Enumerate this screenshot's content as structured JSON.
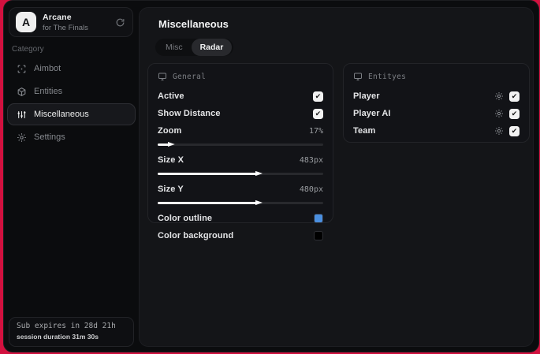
{
  "window": {
    "accent_edge_color": "#d2113f"
  },
  "sidebar": {
    "brand": {
      "initial": "A",
      "title": "Arcane",
      "subtitle": "for The Finals",
      "action_icon": "refresh-icon"
    },
    "category_label": "Category",
    "items": [
      {
        "label": "Aimbot",
        "icon": "crosshair-icon",
        "active": false
      },
      {
        "label": "Entities",
        "icon": "entities-icon",
        "active": false
      },
      {
        "label": "Miscellaneous",
        "icon": "sliders-icon",
        "active": true
      },
      {
        "label": "Settings",
        "icon": "gear-icon",
        "active": false
      }
    ],
    "footer": {
      "line1": "Sub expires in 28d 21h",
      "line2": "session duration 31m 30s"
    }
  },
  "main": {
    "title": "Miscellaneous",
    "tabs": [
      {
        "label": "Misc",
        "active": false
      },
      {
        "label": "Radar",
        "active": true
      }
    ],
    "general": {
      "header": "General",
      "header_icon": "monitor-icon",
      "toggles": [
        {
          "label": "Active",
          "checked": true,
          "check_glyph": "✔"
        },
        {
          "label": "Show Distance",
          "checked": true,
          "check_glyph": "✔"
        }
      ],
      "sliders": [
        {
          "label": "Zoom",
          "value": "17%",
          "percent": 7
        },
        {
          "label": "Size X",
          "value": "483px",
          "percent": 60
        },
        {
          "label": "Size Y",
          "value": "480px",
          "percent": 60
        }
      ],
      "colors": [
        {
          "label": "Color outline",
          "color": "#4a8fe0"
        },
        {
          "label": "Color background",
          "color": "#000000"
        }
      ]
    },
    "entities": {
      "header": "Entityes",
      "header_icon": "monitor-icon",
      "rows": [
        {
          "label": "Player",
          "checked": true,
          "check_glyph": "✔"
        },
        {
          "label": "Player AI",
          "checked": true,
          "check_glyph": "✔"
        },
        {
          "label": "Team",
          "checked": true,
          "check_glyph": "✔"
        }
      ]
    }
  }
}
